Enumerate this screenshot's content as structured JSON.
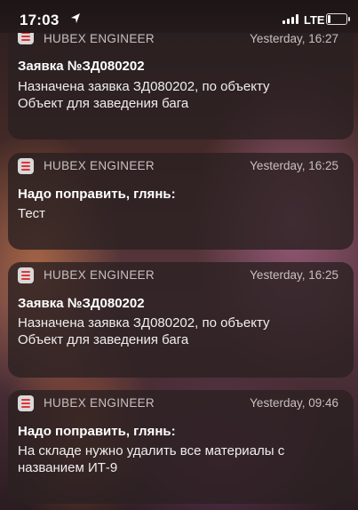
{
  "status_bar": {
    "time": "17:03",
    "network": "LTE",
    "icons": [
      "location-arrow-icon",
      "signal-icon",
      "battery-icon"
    ]
  },
  "notifications": [
    {
      "app": "HUBEX ENGINEER",
      "time": "Yesterday, 16:27",
      "title": "Заявка №ЗД080202",
      "lines": [
        "Назначена заявка  ЗД080202, по объекту",
        "Объект для заведения бага"
      ]
    },
    {
      "app": "HUBEX ENGINEER",
      "time": "Yesterday, 16:25",
      "title": "Надо поправить, глянь:",
      "lines": [
        "Тест"
      ]
    },
    {
      "app": "HUBEX ENGINEER",
      "time": "Yesterday, 16:25",
      "title": "Заявка №ЗД080202",
      "lines": [
        "Назначена заявка  ЗД080202, по объекту",
        "Объект для заведения бага"
      ]
    },
    {
      "app": "HUBEX ENGINEER",
      "time": "Yesterday, 09:46",
      "title": "Надо поправить, глянь:",
      "lines": [
        "На складе нужно удалить все материалы с",
        "названием ИТ-9"
      ]
    }
  ],
  "colors": {
    "app_icon_accent": "#e0343a"
  }
}
